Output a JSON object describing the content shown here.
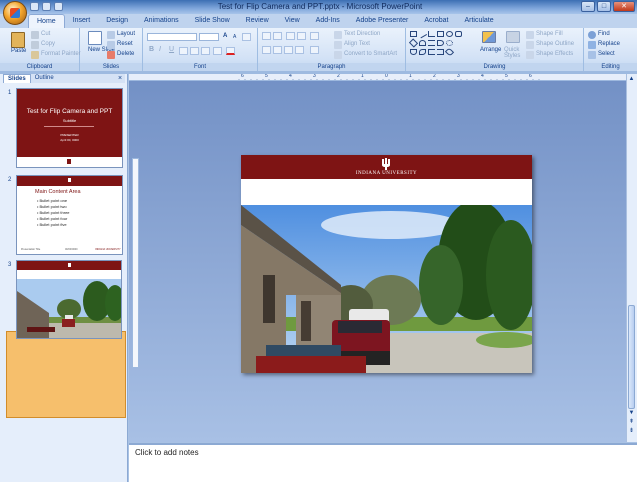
{
  "window": {
    "title": "Test for Flip Camera and PPT.pptx - Microsoft PowerPoint",
    "controls": [
      "–",
      "□",
      "✕"
    ]
  },
  "ribbon_tabs": [
    "Home",
    "Insert",
    "Design",
    "Animations",
    "Slide Show",
    "Review",
    "View",
    "Add-Ins",
    "Adobe Presenter",
    "Acrobat",
    "Articulate"
  ],
  "active_tab": "Home",
  "clipboard": {
    "paste": "Paste",
    "cut": "Cut",
    "copy": "Copy",
    "format_painter": "Format Painter",
    "label": "Clipboard"
  },
  "slides_group": {
    "new_slide": "New Slide",
    "layout": "Layout",
    "reset": "Reset",
    "delete": "Delete",
    "label": "Slides"
  },
  "font_group": {
    "bold": "B",
    "italic": "I",
    "underline": "U",
    "grow": "A",
    "shrink": "A",
    "label": "Font"
  },
  "paragraph_group": {
    "text_direction": "Text Direction",
    "align_text": "Align Text",
    "convert_smartart": "Convert to SmartArt",
    "label": "Paragraph"
  },
  "drawing_group": {
    "arrange": "Arrange",
    "quick_styles": "Quick Styles",
    "shape_fill": "Shape Fill",
    "shape_outline": "Shape Outline",
    "shape_effects": "Shape Effects",
    "label": "Drawing"
  },
  "editing_group": {
    "find": "Find",
    "replace": "Replace",
    "select": "Select",
    "label": "Editing"
  },
  "panel": {
    "tabs": [
      "Slides",
      "Outline"
    ],
    "close": "×",
    "thumbnails": [
      {
        "number": "1",
        "title": "Test for Flip Camera and PPT",
        "subtitle": "Subtitle",
        "line1": "PRESENTER",
        "line2": "April 00, 0000"
      },
      {
        "number": "2",
        "title": "Main Content Area",
        "bullets": [
          "Bullet point one",
          "Bullet point two",
          "Bullet point three",
          "Bullet point four",
          "Bullet point five"
        ],
        "footer_left": "Presentation Title",
        "footer_mid": "00/00/0000",
        "footer_right": "INDIANA UNIVERSITY"
      },
      {
        "number": "3"
      }
    ]
  },
  "slide": {
    "university": "INDIANA UNIVERSITY"
  },
  "ruler_marks": [
    "6",
    "5",
    "4",
    "3",
    "2",
    "1",
    "0",
    "1",
    "2",
    "3",
    "4",
    "5",
    "6"
  ],
  "notes": {
    "placeholder": "Click to add notes"
  },
  "colors": {
    "iu_crimson": "#7e1414",
    "ribbon_text": "#15428b"
  }
}
